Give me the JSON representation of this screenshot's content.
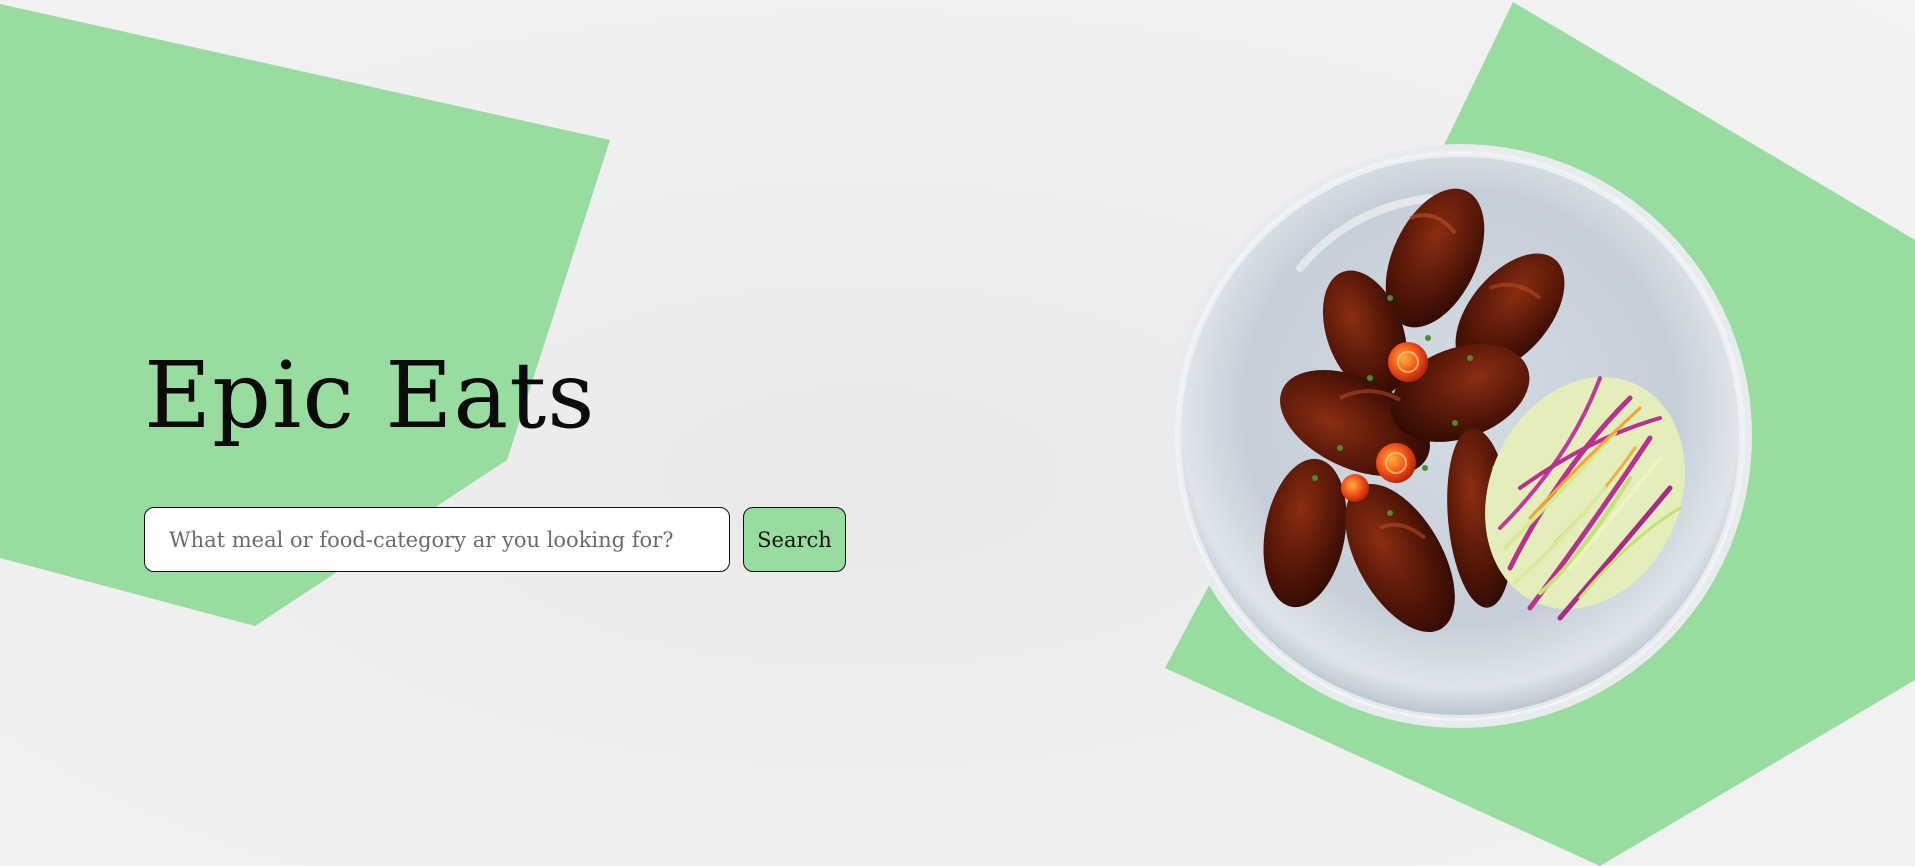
{
  "hero": {
    "title": "Epic Eats"
  },
  "search": {
    "placeholder": "What meal or food-category ar you looking for?",
    "value": "",
    "button_label": "Search"
  },
  "photo": {
    "description": "Plate of glazed chicken wings with coleslaw"
  },
  "colors": {
    "accent_green": "#98dc9f",
    "background": "#efefef",
    "text": "#0b0b0b"
  }
}
